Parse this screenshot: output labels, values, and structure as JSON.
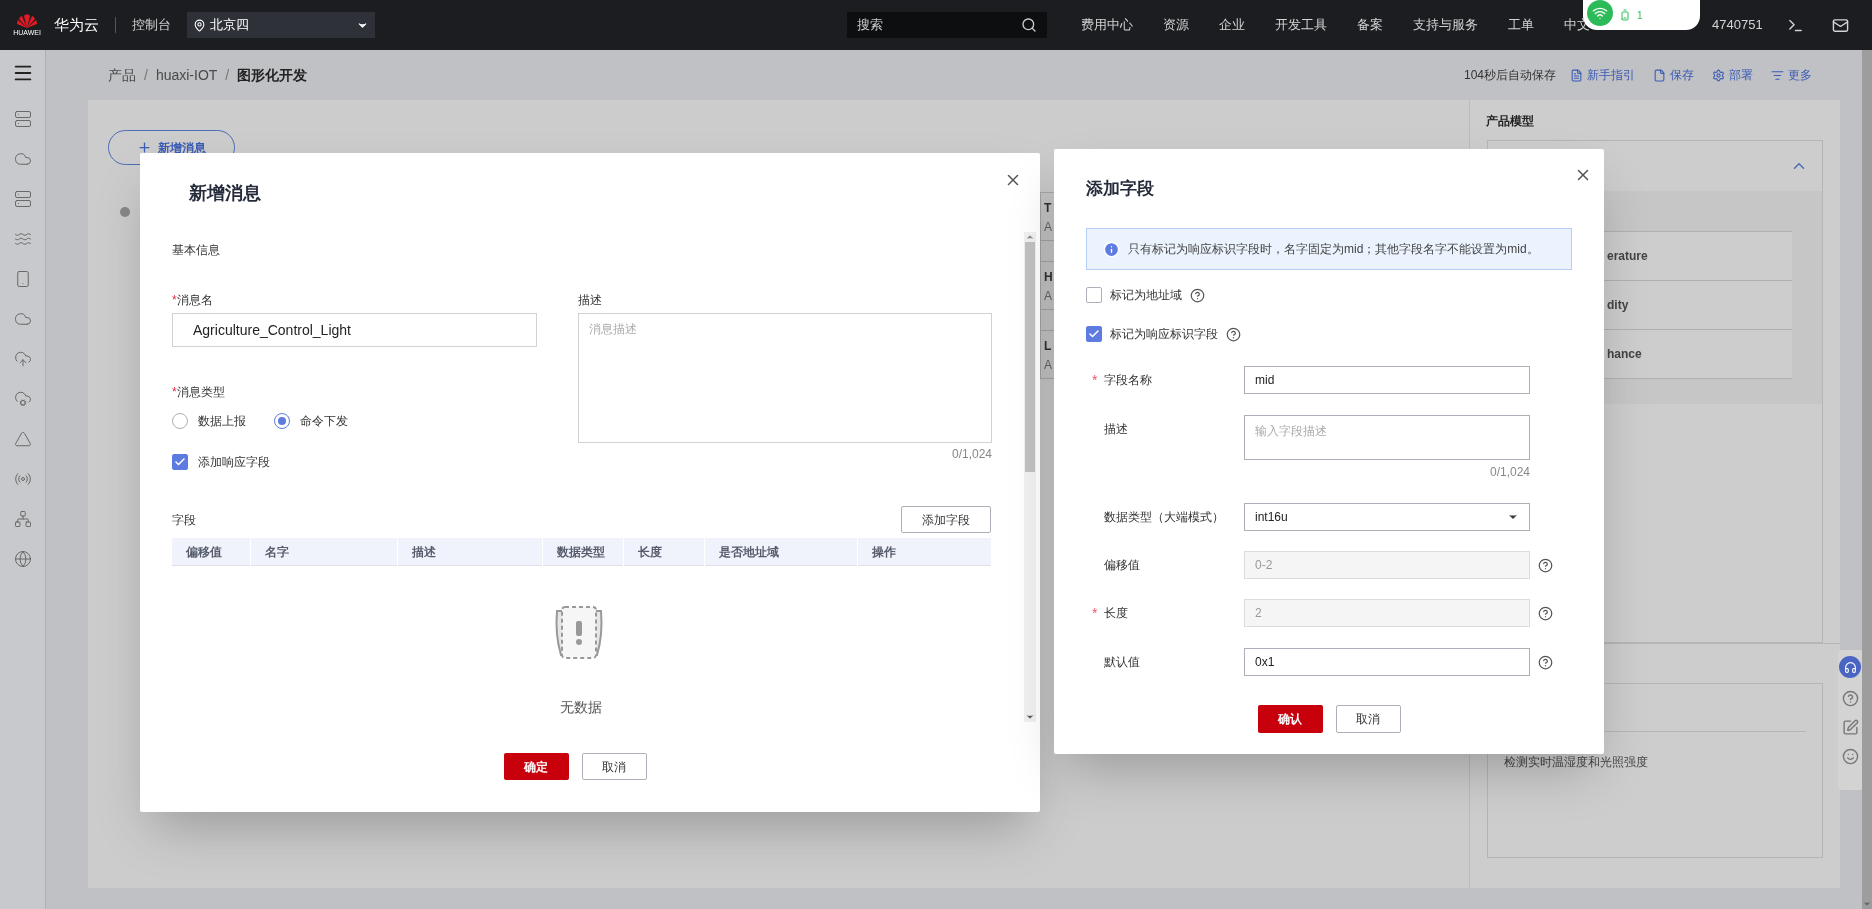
{
  "top_bar": {
    "logo_caption": "HUAWEI",
    "brand": "华为云",
    "console": "控制台",
    "region": "北京四",
    "search_placeholder": "搜索",
    "nav": [
      "费用中心",
      "资源",
      "企业",
      "开发工具",
      "备案",
      "支持与服务",
      "工单",
      "中文"
    ],
    "account": "4740751"
  },
  "phone_popup": {
    "battery": "1"
  },
  "breadcrumb": [
    {
      "label": "产品",
      "kind": "link"
    },
    {
      "label": "/",
      "kind": "separator"
    },
    {
      "label": "huaxi-IOT",
      "kind": "link"
    },
    {
      "label": "/",
      "kind": "separator"
    },
    {
      "label": "图形化开发",
      "kind": "current"
    }
  ],
  "autosave": "104秒后自动保存",
  "actions": [
    "新手指引",
    "保存",
    "部署",
    "更多"
  ],
  "canvas": {
    "new_message_button": "新增消息",
    "message_list": [
      {
        "title": "T",
        "subtitle": "A"
      },
      {
        "title": "H",
        "subtitle": "A"
      },
      {
        "title": "L",
        "subtitle": "A"
      }
    ]
  },
  "right_panel": {
    "title": "产品模型",
    "expanded": true,
    "properties": [
      "erature",
      "dity",
      "hance"
    ],
    "description": "检测实时温湿度和光照强度"
  },
  "add_message_dialog": {
    "title": "新增消息",
    "section": "基本信息",
    "name_field": {
      "mark": "*",
      "label": "消息名",
      "value": "Agriculture_Control_Light"
    },
    "description_field": {
      "label": "描述",
      "placeholder": "消息描述",
      "counter": "0/1,024"
    },
    "type_field": {
      "mark": "*",
      "label": "消息类型",
      "options": [
        {
          "label": "数据上报",
          "selected": false
        },
        {
          "label": "命令下发",
          "selected": true
        }
      ]
    },
    "response_checkbox": {
      "label": "添加响应字段",
      "checked": true
    },
    "fields_label": "字段",
    "add_field_button": "添加字段",
    "table": {
      "columns": [
        "偏移值",
        "名字",
        "描述",
        "数据类型",
        "长度",
        "是否地址域",
        "操作"
      ],
      "empty_text": "无数据"
    },
    "buttons": [
      "确定",
      "取消"
    ]
  },
  "add_field_dialog": {
    "title": "添加字段",
    "info": "只有标记为响应标识字段时，名字固定为mid；其他字段名字不能设置为mid。",
    "checkboxes": [
      {
        "label": "标记为地址域",
        "checked": false
      },
      {
        "label": "标记为响应标识字段",
        "checked": true
      }
    ],
    "fields": [
      {
        "kind": "input",
        "mark": "*",
        "label": "字段名称",
        "value": "mid",
        "disabled": false,
        "help": false
      },
      {
        "kind": "textarea",
        "label": "描述",
        "placeholder": "输入字段描述",
        "counter": "0/1,024",
        "disabled": false,
        "help": false
      },
      {
        "kind": "select",
        "label": "数据类型（大端模式）",
        "value": "int16u",
        "disabled": false,
        "help": false
      },
      {
        "kind": "input",
        "label": "偏移值",
        "value": "0-2",
        "disabled": true,
        "help": true
      },
      {
        "kind": "input",
        "mark": "*",
        "label": "长度",
        "value": "2",
        "disabled": true,
        "help": true
      },
      {
        "kind": "input",
        "label": "默认值",
        "value": "0x1",
        "disabled": false,
        "help": true
      }
    ],
    "buttons": [
      "确认",
      "取消"
    ]
  }
}
